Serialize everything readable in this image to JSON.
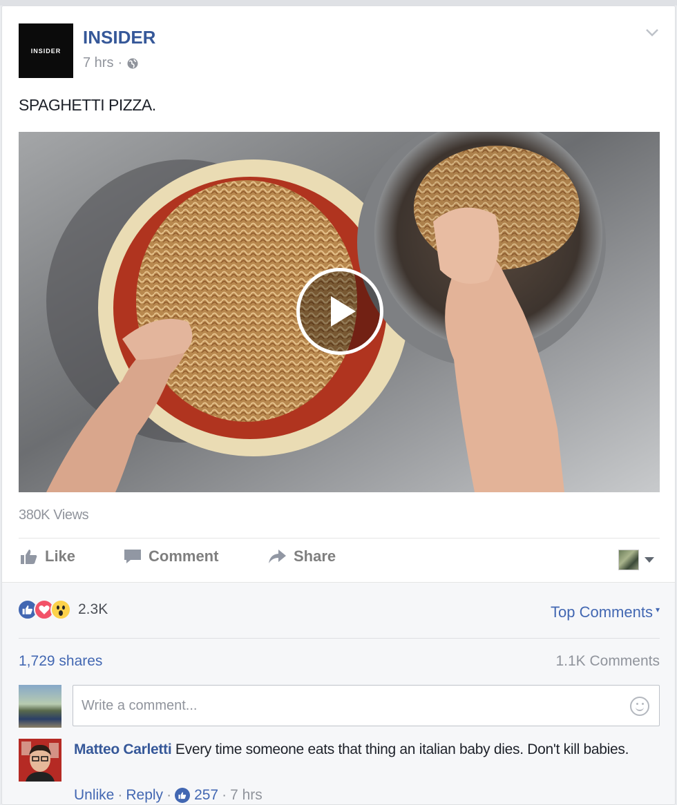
{
  "post": {
    "page_name": "INSIDER",
    "logo_text": "INSIDER",
    "time": "7 hrs",
    "privacy_icon": "globe-icon",
    "caption": "SPAGHETTI PIZZA.",
    "views": "380K Views"
  },
  "actions": {
    "like": "Like",
    "comment": "Comment",
    "share": "Share"
  },
  "feedback": {
    "reaction_count": "2.3K",
    "reactions": [
      "like",
      "love",
      "wow"
    ],
    "top_comments": "Top Comments",
    "shares": "1,729 shares",
    "comments_count": "1.1K Comments",
    "comment_placeholder": "Write a comment..."
  },
  "comment": {
    "author": "Matteo Carletti",
    "text": "Every time someone eats that thing an italian baby dies. Don't kill babies.",
    "unlike": "Unlike",
    "reply": "Reply",
    "likes": "257",
    "time": "7 hrs"
  },
  "colors": {
    "link": "#365899",
    "accent": "#4267b2",
    "muted": "#90949c",
    "love": "#f25268",
    "wow": "#fcd24b"
  }
}
